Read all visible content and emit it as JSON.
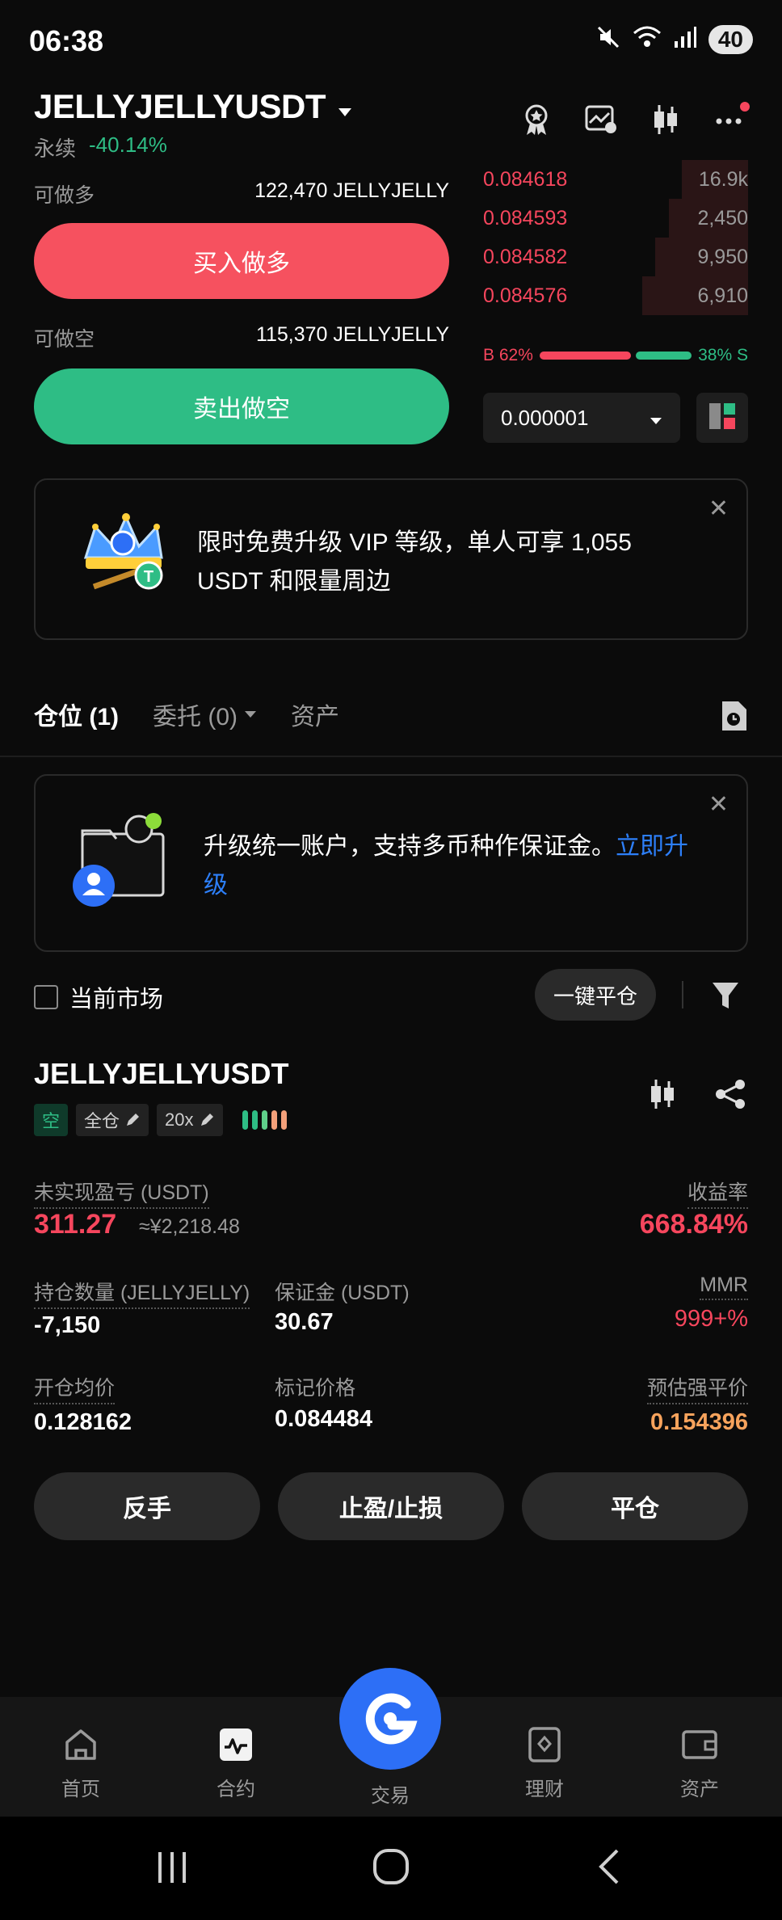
{
  "status_bar": {
    "time": "06:38",
    "battery": "40"
  },
  "header": {
    "pair": "JELLYJELLYUSDT",
    "contract_type": "永续",
    "change": "-40.14%"
  },
  "order_panel": {
    "long_label": "可做多",
    "long_value": "122,470 JELLYJELLY",
    "buy_button": "买入做多",
    "short_label": "可做空",
    "short_value": "115,370 JELLYJELLY",
    "sell_button": "卖出做空"
  },
  "order_book": {
    "asks": [
      {
        "price": "0.084618",
        "size": "16.9k",
        "depth": 0.25
      },
      {
        "price": "0.084593",
        "size": "2,450",
        "depth": 0.3
      },
      {
        "price": "0.084582",
        "size": "9,950",
        "depth": 0.35
      },
      {
        "price": "0.084576",
        "size": "6,910",
        "depth": 0.4
      }
    ],
    "buy_ratio": "B 62%",
    "sell_ratio": "38% S",
    "buy_fraction": 0.62,
    "step": "0.000001"
  },
  "vip_banner": {
    "text": "限时免费升级 VIP 等级，单人可享 1,055 USDT 和限量周边"
  },
  "tabs": {
    "positions": "仓位 (1)",
    "orders": "委托 (0)",
    "assets": "资产"
  },
  "unify_banner": {
    "text": "升级统一账户，支持多币种作保证金。",
    "link": "立即升级"
  },
  "filter": {
    "current_market": "当前市场",
    "close_all": "一键平仓"
  },
  "position": {
    "symbol": "JELLYJELLYUSDT",
    "side": "空",
    "margin_mode": "全仓",
    "leverage": "20x",
    "unrealized_pnl_label": "未实现盈亏 (USDT)",
    "unrealized_pnl": "311.27",
    "unrealized_pnl_cny": "≈¥2,218.48",
    "roe_label": "收益率",
    "roe": "668.84%",
    "size_label": "持仓数量 (JELLYJELLY)",
    "size": "-7,150",
    "margin_label": "保证金 (USDT)",
    "margin": "30.67",
    "mmr_label": "MMR",
    "mmr": "999+%",
    "entry_label": "开仓均价",
    "entry": "0.128162",
    "mark_label": "标记价格",
    "mark": "0.084484",
    "liq_label": "预估强平价",
    "liq": "0.154396",
    "reverse_button": "反手",
    "tpsl_button": "止盈/止损",
    "close_button": "平仓"
  },
  "bottom_nav": {
    "home": "首页",
    "futures": "合约",
    "trade": "交易",
    "earn": "理财",
    "assets": "资产"
  }
}
